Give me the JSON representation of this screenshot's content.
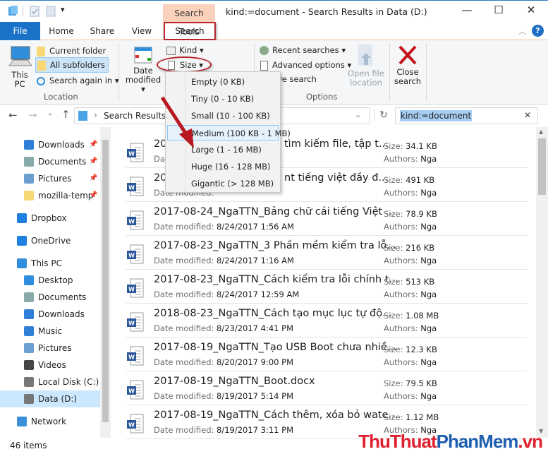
{
  "window": {
    "context_tab": "Search Tools",
    "title": "kind:=document - Search Results in Data (D:)"
  },
  "tabs": [
    {
      "label": "File"
    },
    {
      "label": "Home"
    },
    {
      "label": "Share"
    },
    {
      "label": "View"
    },
    {
      "label": "Search"
    }
  ],
  "ribbon": {
    "location": {
      "this_pc": "This PC",
      "current_folder": "Current folder",
      "all_subfolders": "All subfolders",
      "search_again": "Search again in",
      "group": "Location"
    },
    "refine": {
      "date_modified": "Date modified",
      "kind": "Kind",
      "size": "Size"
    },
    "options": {
      "recent": "Recent searches",
      "advanced": "Advanced options",
      "save": "ve search",
      "open_location": "Open file location",
      "group": "Options"
    },
    "close": {
      "label": "Close search"
    }
  },
  "size_menu": {
    "items": [
      "Empty (0 KB)",
      "Tiny (0 - 10 KB)",
      "Small (10 - 100 KB)",
      "Medium (100 KB - 1 MB)",
      "Large (1 - 16 MB)",
      "Huge (16 - 128 MB)",
      "Gigantic (> 128 MB)"
    ],
    "highlighted": "Medium (100 KB - 1 MB)"
  },
  "address": {
    "path": "Search Results in",
    "search_value": "kind:=document"
  },
  "sidebar": {
    "items": [
      {
        "label": "Downloads",
        "icon": "download-icon",
        "pinned": true
      },
      {
        "label": "Documents",
        "icon": "documents-icon",
        "pinned": true
      },
      {
        "label": "Pictures",
        "icon": "pictures-icon",
        "pinned": true
      },
      {
        "label": "mozilla-temp",
        "icon": "folder-icon",
        "pinned": true
      },
      {
        "label": "Dropbox",
        "icon": "dropbox-icon"
      },
      {
        "label": "OneDrive",
        "icon": "onedrive-icon"
      },
      {
        "label": "This PC",
        "icon": "computer-icon"
      },
      {
        "label": "Desktop",
        "icon": "desktop-icon"
      },
      {
        "label": "Documents",
        "icon": "documents-icon"
      },
      {
        "label": "Downloads",
        "icon": "download-icon"
      },
      {
        "label": "Music",
        "icon": "music-icon"
      },
      {
        "label": "Pictures",
        "icon": "pictures-icon"
      },
      {
        "label": "Videos",
        "icon": "videos-icon"
      },
      {
        "label": "Local Disk (C:)",
        "icon": "drive-icon"
      },
      {
        "label": "Data (D:)",
        "icon": "drive-icon",
        "selected": true
      },
      {
        "label": "Network",
        "icon": "network-icon"
      }
    ]
  },
  "labels": {
    "date": "Date modified:",
    "size": "Size:",
    "authors": "Authors:"
  },
  "files": [
    {
      "name": "20",
      "name_tail": "tìm kiếm file, tập t...",
      "date": "",
      "size": "34.1 KB",
      "author": "Nga"
    },
    {
      "name": "20",
      "name_tail": "nt tiếng việt đầy đ...",
      "date": "",
      "size": "491 KB",
      "author": "Nga"
    },
    {
      "name": "2017-08-24_NgaTTN_Bảng chữ cái tiếng Việt ...",
      "date": "8/24/2017 1:56 AM",
      "size": "78.9 KB",
      "author": "Nga"
    },
    {
      "name": "2017-08-23_NgaTTN_3 Phần mềm kiểm tra lỗ...",
      "date": "8/24/2017 1:16 AM",
      "size": "216 KB",
      "author": "Nga"
    },
    {
      "name": "2017-08-23_NgaTTN_Cách kiểm tra lỗi chính t...",
      "date": "8/24/2017 12:59 AM",
      "size": "513 KB",
      "author": "Nga"
    },
    {
      "name": "2018-08-23_NgaTTN_Cách tạo mục lục tự độ...",
      "date": "8/23/2017 4:41 PM",
      "size": "1.08 MB",
      "author": "Nga"
    },
    {
      "name": "2017-08-19_NgaTTN_Tạo USB Boot chưa nhiề...",
      "date": "8/20/2017 9:00 PM",
      "size": "12.3 KB",
      "author": "Nga"
    },
    {
      "name": "2017-08-19_NgaTTN_Boot.docx",
      "date": "8/19/2017 5:14 PM",
      "size": "79.5 KB",
      "author": "Nga"
    },
    {
      "name": "2017-08-19_NgaTTN_Cách thêm, xóa bỏ wate...",
      "date": "8/19/2017 3:11 PM",
      "size": "1.12 MB",
      "author": "Nga"
    }
  ],
  "status": {
    "count": "46 items"
  },
  "watermark": {
    "part1": "ThuThuat",
    "part2": "PhanMem",
    "part3": ".vn"
  },
  "colors": {
    "accent": "#1a73c8",
    "annotation": "#b8262e",
    "context_tab": "#fbd1bb"
  }
}
